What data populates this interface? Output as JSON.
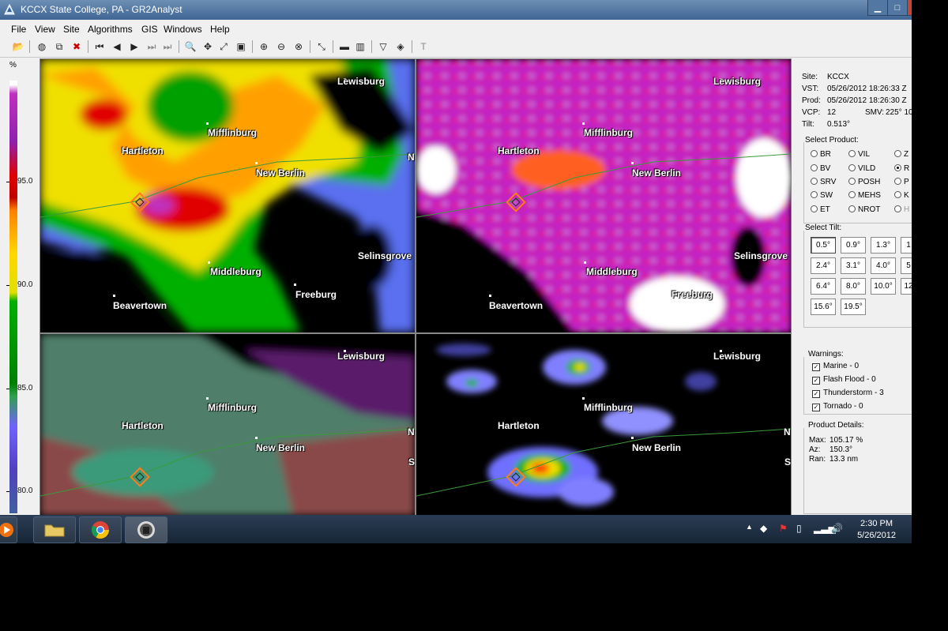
{
  "window": {
    "title": "KCCX State College, PA - GR2Analyst",
    "controls": {
      "minimize": "▁",
      "maximize": "□",
      "close": "✕"
    }
  },
  "menu": [
    "File",
    "View",
    "Site",
    "Algorithms",
    "GIS",
    "Windows",
    "Help"
  ],
  "legend": {
    "unit": "%",
    "ticks": [
      "95.0",
      "90.0",
      "85.0",
      "80.0"
    ]
  },
  "cities": {
    "lewisburg": "Lewisburg",
    "mifflinburg": "Mifflinburg",
    "hartleton": "Hartleton",
    "new_berlin": "New Berlin",
    "selinsgrove": "Selinsgrove",
    "middleburg": "Middleburg",
    "freeburg": "Freeburg",
    "beavertown": "Beavertown",
    "edge_n": "N",
    "edge_s": "S"
  },
  "site_info": {
    "site_label": "Site:",
    "site": "KCCX",
    "vst_label": "VST:",
    "vst": "05/26/2012  18:26:33 Z",
    "prod_label": "Prod:",
    "prod": "05/26/2012  18:26:30 Z",
    "vcp_label": "VCP:",
    "vcp": "12",
    "smv_label": "SMV:",
    "smv": "225° 10",
    "tilt_label": "Tilt:",
    "tilt": "0.513°"
  },
  "select_product": {
    "title": "Select Product:",
    "col1": [
      "BR",
      "BV",
      "SRV",
      "SW",
      "ET"
    ],
    "col2": [
      "VIL",
      "VILD",
      "POSH",
      "MEHS",
      "NROT"
    ],
    "col3": [
      "Z",
      "R",
      "P",
      "K",
      "H"
    ],
    "selected": "R"
  },
  "select_tilt": {
    "title": "Select Tilt:",
    "rows": [
      [
        "0.5°",
        "0.9°",
        "1.3°",
        "1"
      ],
      [
        "2.4°",
        "3.1°",
        "4.0°",
        "5"
      ],
      [
        "6.4°",
        "8.0°",
        "10.0°",
        "12"
      ],
      [
        "15.6°",
        "19.5°"
      ]
    ],
    "selected": "0.5°"
  },
  "warnings": {
    "title": "Warnings:",
    "items": [
      "Marine - 0",
      "Flash Flood - 0",
      "Thunderstorm - 3",
      "Tornado - 0"
    ]
  },
  "product_details": {
    "title": "Product Details:",
    "max_label": "Max:",
    "max": "105.17 %",
    "az_label": "Az:",
    "az": "150.3°",
    "ran_label": "Ran:",
    "ran": "13.3 nm"
  },
  "taskbar": {
    "time": "2:30 PM",
    "date": "5/26/2012"
  }
}
